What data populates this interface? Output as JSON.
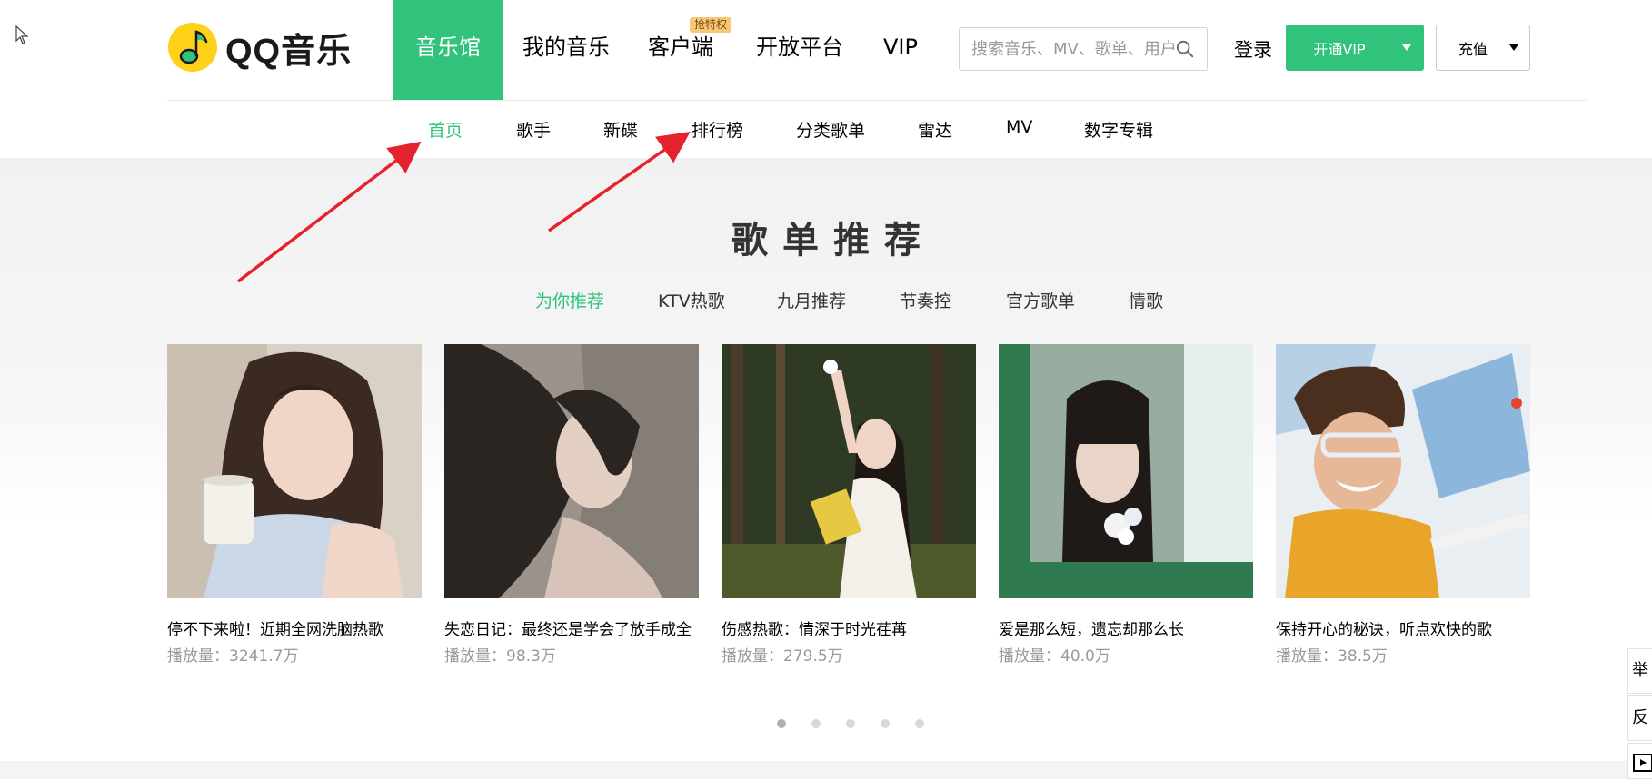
{
  "header": {
    "logo_text": "QQ音乐",
    "nav": [
      {
        "label": "音乐馆",
        "active": true
      },
      {
        "label": "我的音乐",
        "active": false
      },
      {
        "label": "客户端",
        "active": false,
        "badge": "抢特权"
      },
      {
        "label": "开放平台",
        "active": false
      },
      {
        "label": "VIP",
        "active": false
      }
    ],
    "search": {
      "placeholder": "搜索音乐、MV、歌单、用户"
    },
    "login_label": "登录",
    "vip_button_label": "开通VIP",
    "charge_button_label": "充值"
  },
  "sub_nav": [
    {
      "label": "首页",
      "active": true
    },
    {
      "label": "歌手",
      "active": false
    },
    {
      "label": "新碟",
      "active": false
    },
    {
      "label": "排行榜",
      "active": false
    },
    {
      "label": "分类歌单",
      "active": false
    },
    {
      "label": "雷达",
      "active": false
    },
    {
      "label": "MV",
      "active": false
    },
    {
      "label": "数字专辑",
      "active": false
    }
  ],
  "section": {
    "title": "歌单推荐",
    "tabs": [
      {
        "label": "为你推荐",
        "active": true
      },
      {
        "label": "KTV热歌",
        "active": false
      },
      {
        "label": "九月推荐",
        "active": false
      },
      {
        "label": "节奏控",
        "active": false
      },
      {
        "label": "官方歌单",
        "active": false
      },
      {
        "label": "情歌",
        "active": false
      }
    ],
    "playlists": [
      {
        "title": "停不下来啦！近期全网洗脑热歌",
        "plays": "播放量：3241.7万"
      },
      {
        "title": "失恋日记：最终还是学会了放手成全",
        "plays": "播放量：98.3万"
      },
      {
        "title": "伤感热歌：情深于时光荏苒",
        "plays": "播放量：279.5万"
      },
      {
        "title": "爱是那么短，遗忘却那么长",
        "plays": "播放量：40.0万"
      },
      {
        "title": "保持开心的秘诀，听点欢快的歌",
        "plays": "播放量：38.5万"
      }
    ],
    "pagination": {
      "pages": 5,
      "current": 1
    }
  },
  "side_buttons": [
    "举报",
    "反馈"
  ],
  "colors": {
    "accent": "#31c27c",
    "annotation": "#e5232e",
    "badge": "#f8c87a"
  }
}
